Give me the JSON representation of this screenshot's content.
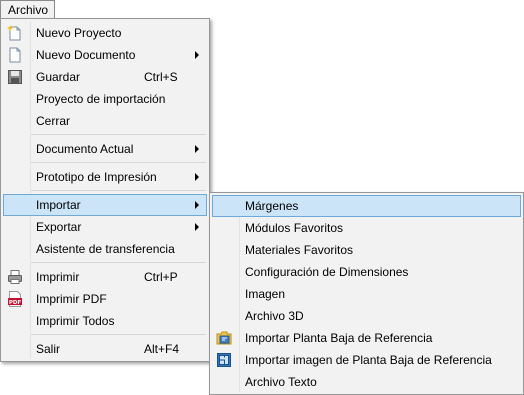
{
  "menubar": {
    "archivo_label": "Archivo"
  },
  "main_menu": {
    "items": [
      {
        "label": "Nuevo Proyecto"
      },
      {
        "label": "Nuevo Documento"
      },
      {
        "label": "Guardar",
        "shortcut": "Ctrl+S"
      },
      {
        "label": "Proyecto de importación"
      },
      {
        "label": "Cerrar"
      },
      {
        "label": "Documento Actual"
      },
      {
        "label": "Prototipo de Impresión"
      },
      {
        "label": "Importar"
      },
      {
        "label": "Exportar"
      },
      {
        "label": "Asistente de transferencia"
      },
      {
        "label": "Imprimir",
        "shortcut": "Ctrl+P"
      },
      {
        "label": "Imprimir PDF"
      },
      {
        "label": "Imprimir Todos"
      },
      {
        "label": "Salir",
        "shortcut": "Alt+F4"
      }
    ]
  },
  "sub_menu": {
    "items": [
      {
        "label": "Márgenes"
      },
      {
        "label": "Módulos Favoritos"
      },
      {
        "label": "Materiales Favoritos"
      },
      {
        "label": "Configuración de Dimensiones"
      },
      {
        "label": "Imagen"
      },
      {
        "label": "Archivo 3D"
      },
      {
        "label": "Importar Planta Baja de Referencia"
      },
      {
        "label": "Importar imagen de Planta Baja de Referencia"
      },
      {
        "label": "Archivo Texto"
      }
    ]
  },
  "icons": {
    "pdf_text": "PDF",
    "colors": {
      "highlight_bg": "#cce4f7",
      "highlight_border": "#6fa9d8",
      "menu_bg": "#f2f2f2"
    }
  }
}
